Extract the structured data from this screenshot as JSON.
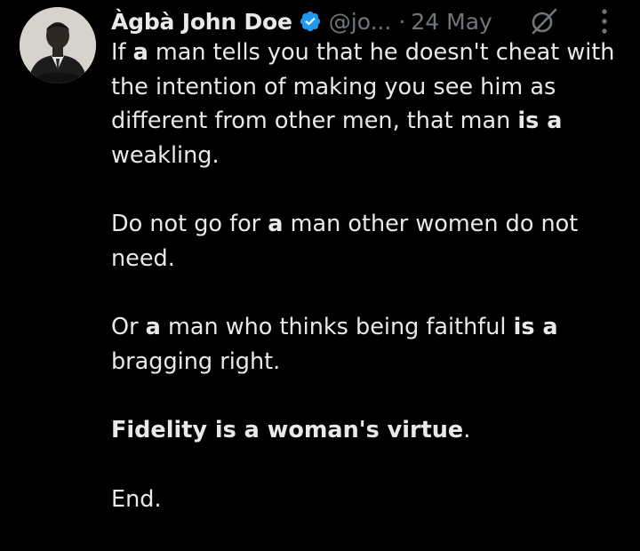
{
  "tweet": {
    "author": {
      "display_name": "Àgbà John Doe",
      "handle": "@jo...",
      "verified": true,
      "verified_color": "#1d9bf0"
    },
    "separator": "·",
    "date": "24 May",
    "icons": {
      "edited": "pencil-slash-icon",
      "more": "more-vertical-icon"
    },
    "paragraphs": [
      [
        {
          "t": "If ",
          "b": false
        },
        {
          "t": "a",
          "b": true
        },
        {
          "t": " man tells you that he doesn't cheat with the intention of making you see him as different from other men, that man ",
          "b": false
        },
        {
          "t": "is a",
          "b": true
        },
        {
          "t": " weakling.",
          "b": false
        }
      ],
      [
        {
          "t": "Do not go for ",
          "b": false
        },
        {
          "t": "a",
          "b": true
        },
        {
          "t": " man other women do not need.",
          "b": false
        }
      ],
      [
        {
          "t": "Or ",
          "b": false
        },
        {
          "t": "a",
          "b": true
        },
        {
          "t": " man who thinks being faithful ",
          "b": false
        },
        {
          "t": "is a",
          "b": true
        },
        {
          "t": " bragging right.",
          "b": false
        }
      ],
      [
        {
          "t": "Fidelity is a woman's virtue",
          "b": true
        },
        {
          "t": ".",
          "b": false
        }
      ],
      [
        {
          "t": "End.",
          "b": false
        }
      ]
    ]
  },
  "colors": {
    "background": "#000000",
    "text": "#e7e9ea",
    "muted": "#71767b"
  }
}
